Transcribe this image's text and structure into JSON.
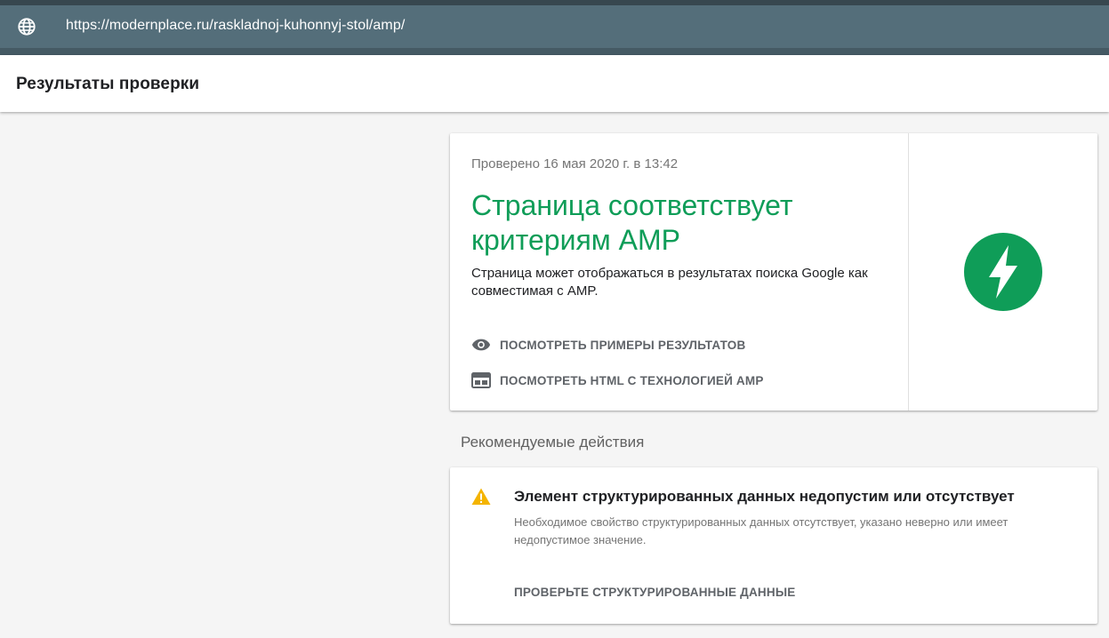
{
  "browser": {
    "url": "https://modernplace.ru/raskladnoj-kuhonnyj-stol/amp/",
    "globe_icon": "globe-icon"
  },
  "header": {
    "title": "Результаты проверки"
  },
  "result_card": {
    "checked_time": "Проверено 16 мая 2020 г. в 13:42",
    "status_title": "Страница соответствует критериям AMP",
    "status_desc": "Страница может отображаться в результатах поиска Google как совместимая с AMP.",
    "view_results_label": "ПОСМОТРЕТЬ ПРИМЕРЫ РЕЗУЛЬТАТОВ",
    "view_html_label": "ПОСМОТРЕТЬ HTML С ТЕХНОЛОГИЕЙ AMP",
    "status_icon": "amp-lightning-icon",
    "accent_color": "#0f9d58"
  },
  "recommendations": {
    "section_title": "Рекомендуемые действия",
    "items": [
      {
        "icon": "warning-icon",
        "title": "Элемент структурированных данных недопустим или отсутствует",
        "description": "Необходимое свойство структурированных данных отсутствует, указано неверно или имеет недопустимое значение.",
        "action_label": "ПРОВЕРЬТЕ СТРУКТУРИРОВАННЫЕ ДАННЫЕ",
        "icon_color": "#f4b400"
      }
    ]
  }
}
